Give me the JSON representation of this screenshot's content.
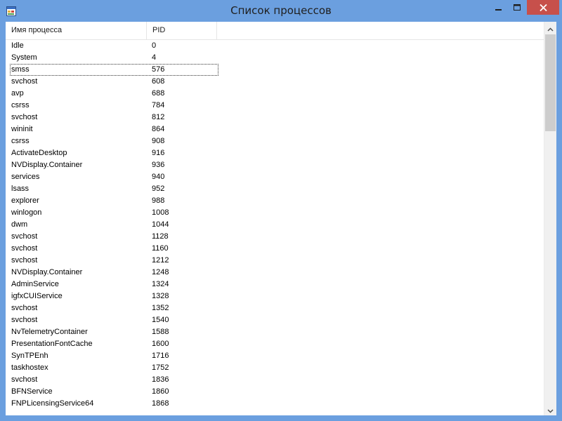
{
  "window": {
    "title": "Список процессов"
  },
  "columns": {
    "name": "Имя процесса",
    "pid": "PID"
  },
  "rows": [
    {
      "name": "Idle",
      "pid": "0"
    },
    {
      "name": "System",
      "pid": "4"
    },
    {
      "name": "smss",
      "pid": "576"
    },
    {
      "name": "svchost",
      "pid": "608"
    },
    {
      "name": "avp",
      "pid": "688"
    },
    {
      "name": "csrss",
      "pid": "784"
    },
    {
      "name": "svchost",
      "pid": "812"
    },
    {
      "name": "wininit",
      "pid": "864"
    },
    {
      "name": "csrss",
      "pid": "908"
    },
    {
      "name": "ActivateDesktop",
      "pid": "916"
    },
    {
      "name": "NVDisplay.Container",
      "pid": "936"
    },
    {
      "name": "services",
      "pid": "940"
    },
    {
      "name": "lsass",
      "pid": "952"
    },
    {
      "name": "explorer",
      "pid": "988"
    },
    {
      "name": "winlogon",
      "pid": "1008"
    },
    {
      "name": "dwm",
      "pid": "1044"
    },
    {
      "name": "svchost",
      "pid": "1128"
    },
    {
      "name": "svchost",
      "pid": "1160"
    },
    {
      "name": "svchost",
      "pid": "1212"
    },
    {
      "name": "NVDisplay.Container",
      "pid": "1248"
    },
    {
      "name": "AdminService",
      "pid": "1324"
    },
    {
      "name": "igfxCUIService",
      "pid": "1328"
    },
    {
      "name": "svchost",
      "pid": "1352"
    },
    {
      "name": "svchost",
      "pid": "1540"
    },
    {
      "name": "NvTelemetryContainer",
      "pid": "1588"
    },
    {
      "name": "PresentationFontCache",
      "pid": "1600"
    },
    {
      "name": "SynTPEnh",
      "pid": "1716"
    },
    {
      "name": "taskhostex",
      "pid": "1752"
    },
    {
      "name": "svchost",
      "pid": "1836"
    },
    {
      "name": "BFNService",
      "pid": "1860"
    },
    {
      "name": "FNPLicensingService64",
      "pid": "1868"
    }
  ],
  "focused_row": 2,
  "colors": {
    "titlebar": "#6b9fdf",
    "close": "#c7504b"
  },
  "icons": {
    "app": "window-app-icon",
    "minimize": "minimize-icon",
    "maximize": "maximize-icon",
    "close": "close-icon",
    "scroll_up": "chevron-up-icon",
    "scroll_down": "chevron-down-icon"
  }
}
